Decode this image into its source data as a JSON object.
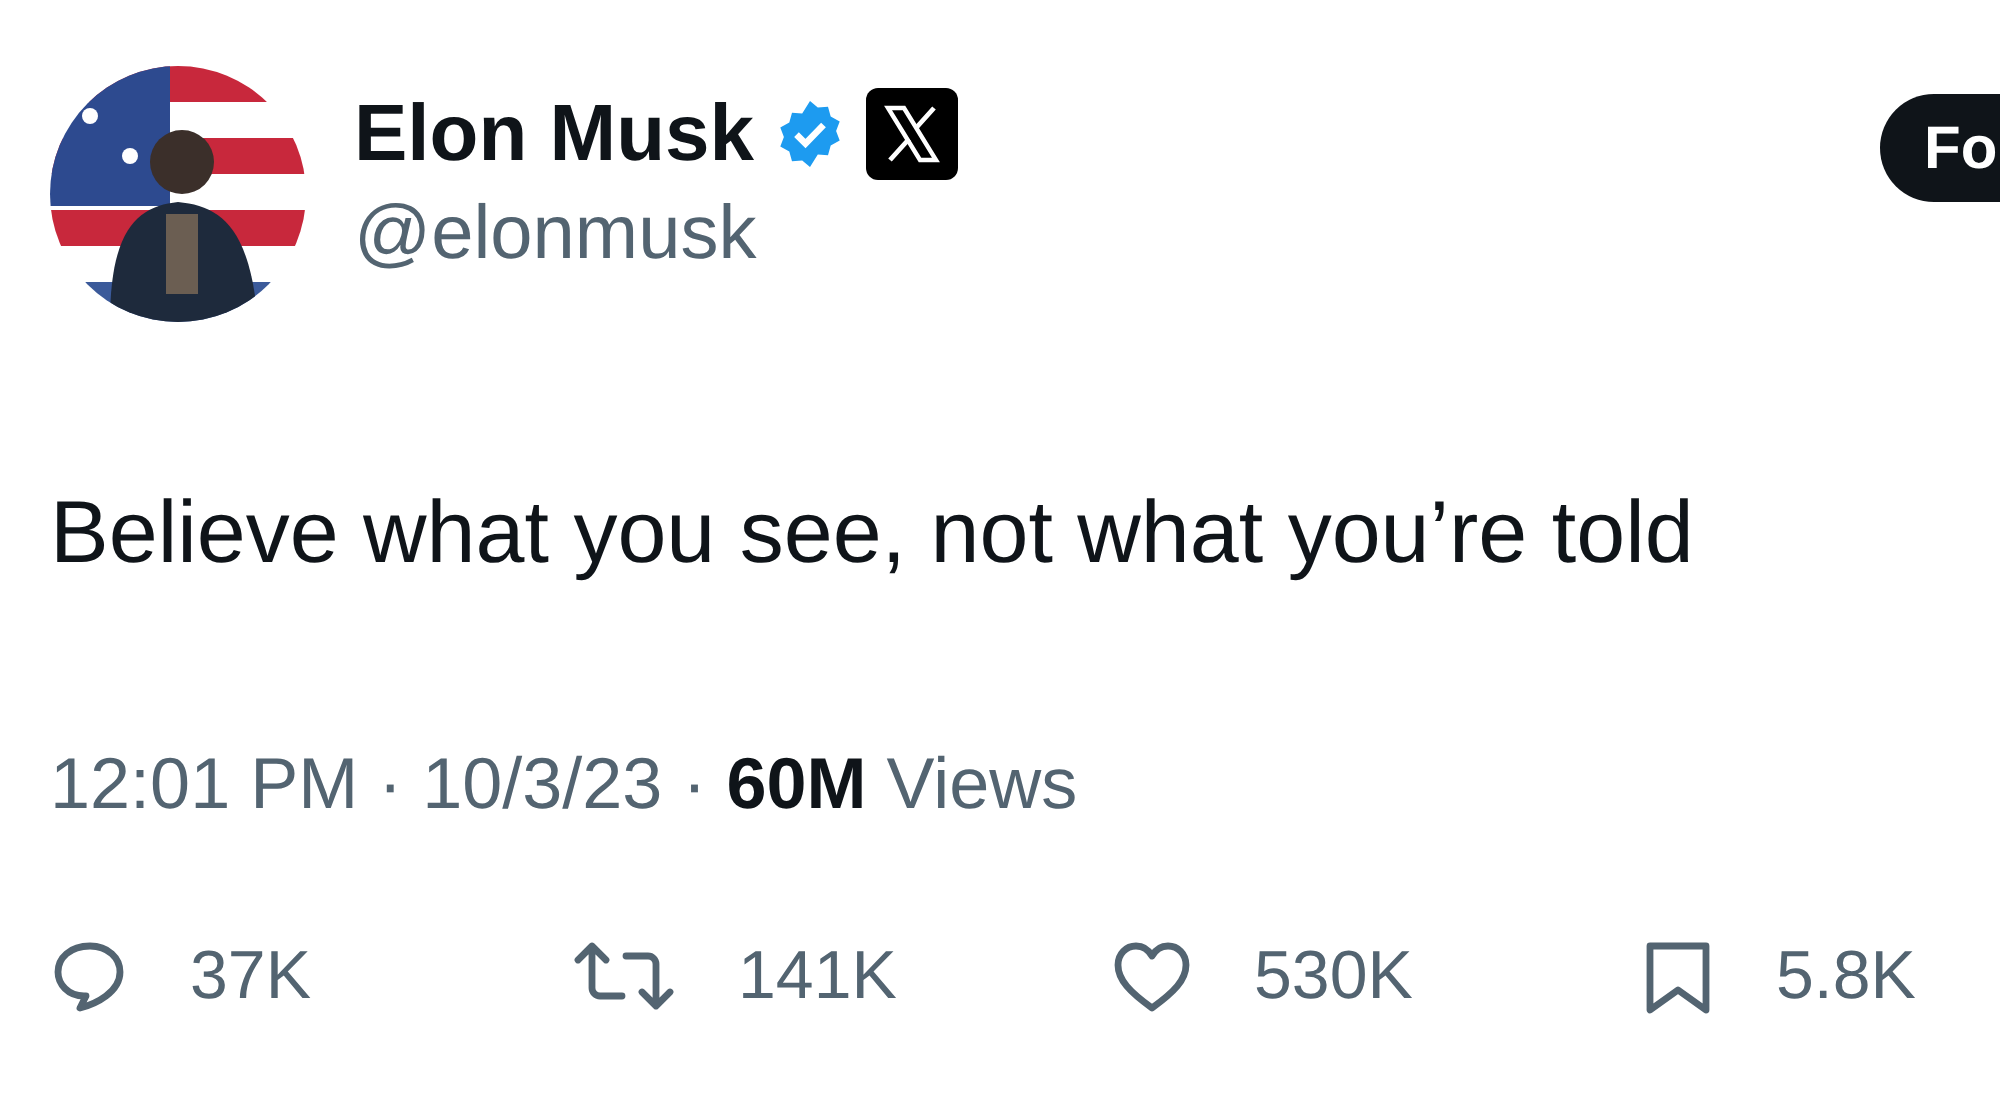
{
  "author": {
    "name": "Elon Musk",
    "handle": "@elonmusk",
    "verified": true,
    "affiliation_badge": true
  },
  "follow_button": {
    "label": "Fo"
  },
  "tweet": {
    "text": "Believe what you see, not what you’re told"
  },
  "meta": {
    "time": "12:01 PM",
    "separator_1": "·",
    "date": "10/3/23",
    "separator_2": "·",
    "views_count": "60M",
    "views_label": "Views"
  },
  "actions": [
    {
      "kind": "reply",
      "count": "37K"
    },
    {
      "kind": "repost",
      "count": "141K"
    },
    {
      "kind": "like",
      "count": "530K"
    },
    {
      "kind": "bookmark",
      "count": "5.8K"
    }
  ]
}
